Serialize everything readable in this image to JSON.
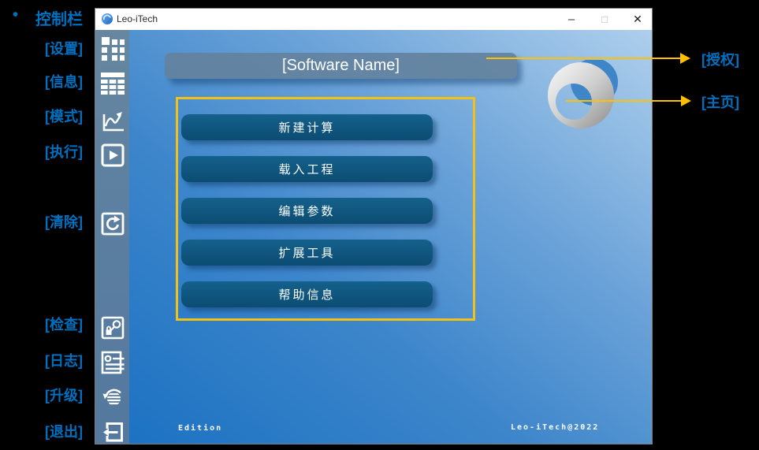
{
  "colors": {
    "annotation_blue": "#0070C0",
    "arrow_yellow": "#FFC000",
    "frame_yellow": "#F3C016",
    "button_dark_blue": "#0C4C72",
    "banner_gray_blue": "#63829E",
    "sidebar_steel_blue": "#5D80A1",
    "main_gradient_dark": "#1C72C2",
    "main_gradient_light": "#AECFEC"
  },
  "annotations": {
    "bullet": "•",
    "left": [
      {
        "label": "控制栏"
      },
      {
        "label": "[设置]"
      },
      {
        "label": "[信息]"
      },
      {
        "label": "[模式]"
      },
      {
        "label": "[执行]"
      },
      {
        "label": "[清除]"
      },
      {
        "label": "[检查]"
      },
      {
        "label": "[日志]"
      },
      {
        "label": "[升级]"
      },
      {
        "label": "[退出]"
      }
    ],
    "right": [
      {
        "label": "[授权]"
      },
      {
        "label": "[主页]"
      }
    ]
  },
  "window": {
    "titlebar": {
      "app_name": "Leo-iTech",
      "minimize_glyph": "–",
      "maximize_glyph": "□",
      "close_glyph": "✕"
    },
    "sidebar": {
      "items": [
        {
          "name": "settings",
          "icon": "grid-icon"
        },
        {
          "name": "info",
          "icon": "table-icon"
        },
        {
          "name": "mode",
          "icon": "curve-chart-icon"
        },
        {
          "name": "run",
          "icon": "play-icon"
        },
        {
          "name": "clear",
          "icon": "refresh-icon"
        },
        {
          "name": "check",
          "icon": "lock-key-icon"
        },
        {
          "name": "log",
          "icon": "document-lines-icon"
        },
        {
          "name": "upgrade",
          "icon": "sync-sphere-icon"
        },
        {
          "name": "exit",
          "icon": "logout-icon"
        }
      ]
    },
    "main": {
      "banner_title": "[Software Name]",
      "buttons": [
        {
          "label": "新建计算"
        },
        {
          "label": "载入工程"
        },
        {
          "label": "编辑参数"
        },
        {
          "label": "扩展工具"
        },
        {
          "label": "帮助信息"
        }
      ],
      "footer_left": "Edition",
      "footer_right": "Leo-iTech@2022"
    }
  }
}
